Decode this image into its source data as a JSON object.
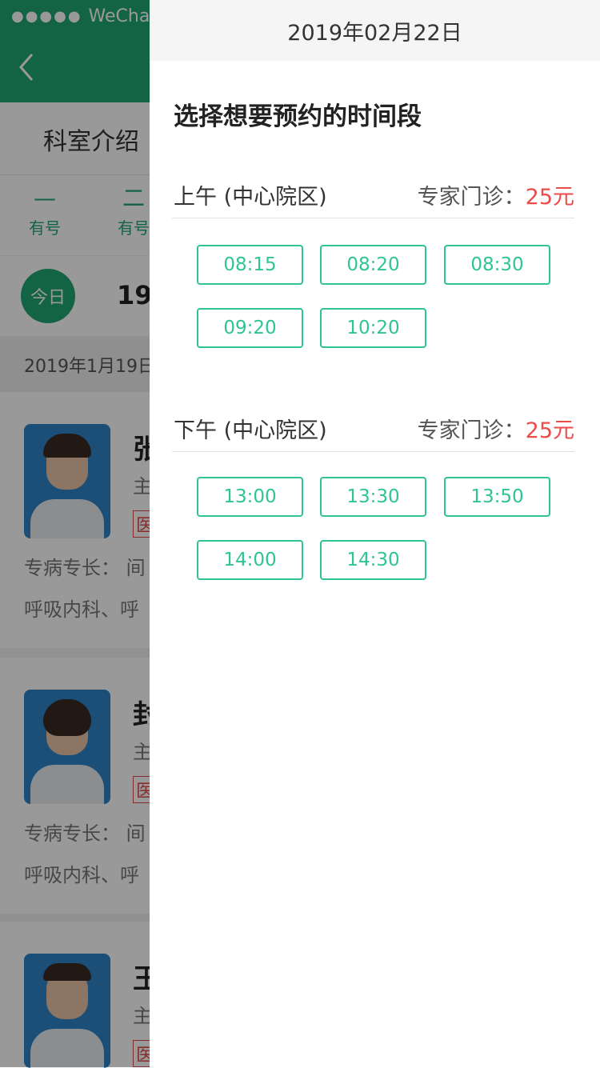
{
  "status_bar": {
    "carrier": "WeChat"
  },
  "background": {
    "tab_intro": "科室介绍",
    "day_tabs": [
      {
        "symbol": "—",
        "label": "有号"
      },
      {
        "symbol": "二",
        "label": "有号"
      }
    ],
    "today_badge": "今日",
    "date_big": "19",
    "date_strip": "2019年1月19日",
    "doctors": [
      {
        "name": "张",
        "title": "主",
        "tag": "医",
        "spec": "专病专长：  间",
        "spec2": "呼吸内科、呼"
      },
      {
        "name": "封",
        "title": "主",
        "tag": "医",
        "spec": "专病专长：  间",
        "spec2": "呼吸内科、呼"
      },
      {
        "name": "王",
        "title": "主",
        "tag": "医",
        "spec": "",
        "spec2": ""
      }
    ]
  },
  "drawer": {
    "date": "2019年02月22日",
    "title": "选择想要预约的时间段",
    "sections": [
      {
        "label": "上午 (中心院区)",
        "clinic": "专家门诊：",
        "price": "25元",
        "slots": [
          "08:15",
          "08:20",
          "08:30",
          "09:20",
          "10:20"
        ]
      },
      {
        "label": "下午 (中心院区)",
        "clinic": "专家门诊：",
        "price": "25元",
        "slots": [
          "13:00",
          "13:30",
          "13:50",
          "14:00",
          "14:30"
        ]
      }
    ]
  },
  "colors": {
    "brand_green": "#1fa774",
    "slot_green": "#2fc58f",
    "price_red": "#ee4b4b"
  },
  "icons": {
    "back": "chevron-left-icon",
    "wifi": "wifi-icon"
  }
}
